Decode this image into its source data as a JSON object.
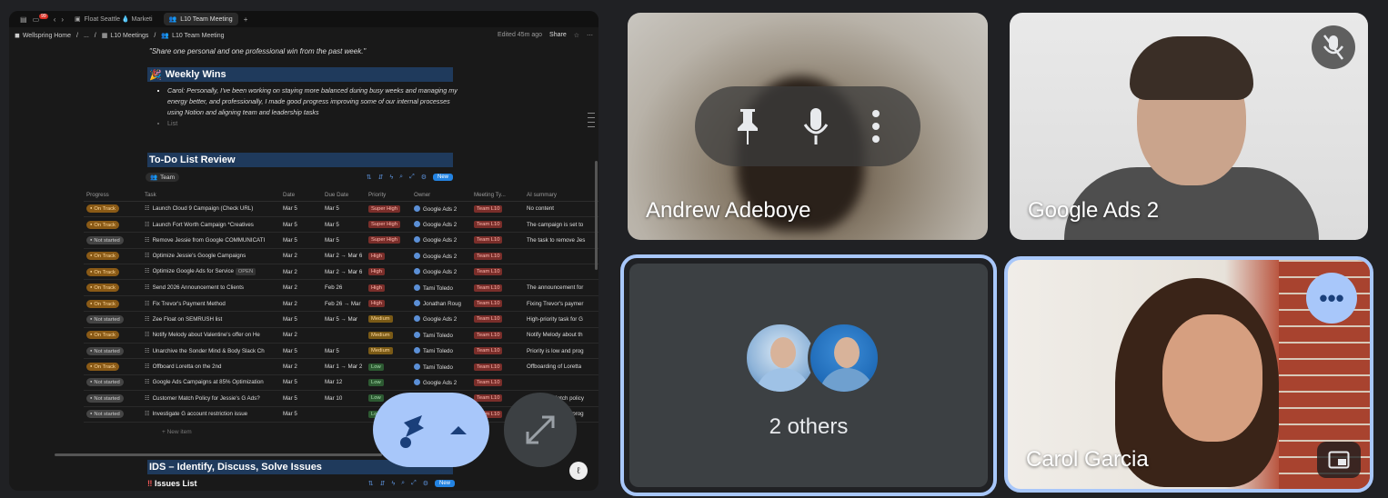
{
  "browser": {
    "tabs": [
      {
        "label": "Float Seattle 💧 Marketi"
      },
      {
        "label": "L10 Team Meeting"
      }
    ],
    "notif_count": "99"
  },
  "breadcrumb": {
    "workspace": "Wellspring Home",
    "ellipsis": "...",
    "parent": "L10 Meetings",
    "page": "L10 Team Meeting",
    "edited": "Edited 45m ago",
    "share": "Share"
  },
  "doc": {
    "quote": "\"Share one personal and one professional win from the past week.\"",
    "weekly_wins_heading": "Weekly Wins",
    "weekly_wins_item": "Carol: Personally, I've been working on staying more balanced during busy weeks and managing my energy better, and professionally, I made good progress improving some of our internal processes using Notion and aligning team and leadership tasks",
    "list_placeholder": "List",
    "todo_heading": "To-Do List Review",
    "view_tab": "Team",
    "new_button": "New",
    "new_item": "New item",
    "ids_heading": "IDS – Identify, Discuss, Solve Issues",
    "issues_heading": "Issues List",
    "issues_new_button": "New"
  },
  "table": {
    "columns": [
      "Progress",
      "Task",
      "Date",
      "Due Date",
      "Priority",
      "Owner",
      "Meeting Ty...",
      "AI summary"
    ],
    "rows": [
      {
        "progress": "On Track",
        "task": "Launch Cloud 9 Campaign (Check URL)",
        "date": "Mar 5",
        "due": "Mar 5",
        "priority": "Super High",
        "owner": "Google Ads 2",
        "meeting": "Team L10",
        "summary": "No content"
      },
      {
        "progress": "On Track",
        "task": "Launch Fort Worth Campaign *Creatives",
        "date": "Mar 5",
        "due": "Mar 5",
        "priority": "Super High",
        "owner": "Google Ads 2",
        "meeting": "Team L10",
        "summary": "The campaign is set to"
      },
      {
        "progress": "Not started",
        "task": "Remove Jessie from Google COMMUNICATI",
        "date": "Mar 5",
        "due": "Mar 5",
        "priority": "Super High",
        "owner": "Google Ads 2",
        "meeting": "Team L10",
        "summary": "The task to remove Jes"
      },
      {
        "progress": "On Track",
        "task": "Optimize Jessie's Google Campaigns",
        "date": "Mar 2",
        "due": "Mar 2 → Mar 6",
        "priority": "High",
        "owner": "Google Ads 2",
        "meeting": "Team L10",
        "summary": ""
      },
      {
        "progress": "On Track",
        "task": "Optimize Google Ads for Service",
        "date": "Mar 2",
        "due": "Mar 2 → Mar 6",
        "priority": "High",
        "owner": "Google Ads 2",
        "meeting": "Team L10",
        "summary": ""
      },
      {
        "progress": "On Track",
        "task": "Send 2026 Announcement to Clients",
        "date": "Mar 2",
        "due": "Feb 26",
        "priority": "High",
        "owner": "Tami Toledo",
        "meeting": "Team L10",
        "summary": "The announcement for"
      },
      {
        "progress": "On Track",
        "task": "Fix Trevor's Payment Method",
        "date": "Mar 2",
        "due": "Feb 26 → Mar",
        "priority": "High",
        "owner": "Jonathan Roug",
        "meeting": "Team L10",
        "summary": "Fixing Trevor's paymer"
      },
      {
        "progress": "Not started",
        "task": "Zee Float on SEMRUSH list",
        "date": "Mar 5",
        "due": "Mar 5 → Mar",
        "priority": "Medium",
        "owner": "Google Ads 2",
        "meeting": "Team L10",
        "summary": "High-priority task for G"
      },
      {
        "progress": "On Track",
        "task": "Notify Melody about Valentine's offer on He",
        "date": "Mar 2",
        "due": "",
        "priority": "Medium",
        "owner": "Tami Toledo",
        "meeting": "Team L10",
        "summary": "Notify Melody about th"
      },
      {
        "progress": "Not started",
        "task": "Unarchive the Sonder Mind & Body Slack Ch",
        "date": "Mar 5",
        "due": "Mar 5",
        "priority": "Medium",
        "owner": "Tami Toledo",
        "meeting": "Team L10",
        "summary": "Priority is low and prog"
      },
      {
        "progress": "On Track",
        "task": "Offboard Loretta on the 2nd",
        "date": "Mar 2",
        "due": "Mar 1 → Mar 2",
        "priority": "Low",
        "owner": "Tami Toledo",
        "meeting": "Team L10",
        "summary": "Offboarding of Loretta"
      },
      {
        "progress": "Not started",
        "task": "Google Ads Campaigns at 85% Optimization",
        "date": "Mar 5",
        "due": "Mar 12",
        "priority": "Low",
        "owner": "Google Ads 2",
        "meeting": "Team L10",
        "summary": ""
      },
      {
        "progress": "Not started",
        "task": "Customer Match Policy for Jessie's G Ads?",
        "date": "Mar 5",
        "due": "Mar 10",
        "priority": "Low",
        "owner": "Google Ads 2",
        "meeting": "Team L10",
        "summary": "Customer Match policy"
      },
      {
        "progress": "Not started",
        "task": "Investigate G account restriction issue",
        "date": "Mar 5",
        "due": "",
        "priority": "Low",
        "owner": "Google Ads 2",
        "meeting": "Team L10",
        "summary": "Priority is low and prog"
      }
    ],
    "open_label": "OPEN"
  },
  "tiles": {
    "andrew": {
      "name": "Andrew Adeboye"
    },
    "google_ads": {
      "name": "Google Ads 2"
    },
    "others": {
      "label": "2 others"
    },
    "carol": {
      "name": "Carol Garcia"
    }
  },
  "colors": {
    "accent": "#a8c7fa",
    "notion_header": "#1f3a5c"
  }
}
